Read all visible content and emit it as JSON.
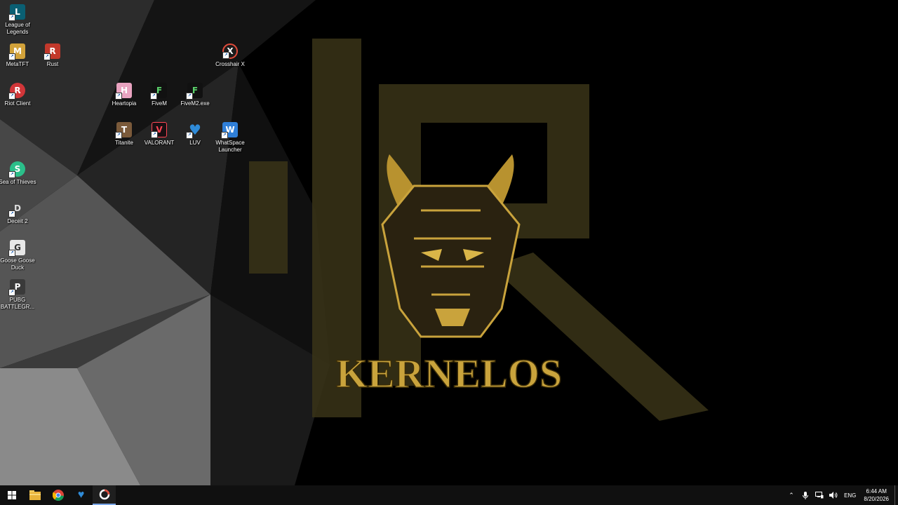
{
  "wallpaper": {
    "brand_text": "KERNELOS",
    "accent_color": "#c9a33c"
  },
  "desktop_icons": [
    {
      "label": "League of Legends",
      "icon": "league-of-legends-icon",
      "color": "#0a5f73",
      "glyph": "L"
    },
    {
      "label": "MetaTFT",
      "icon": "metatft-icon",
      "color": "#d2a23a",
      "glyph": "M"
    },
    {
      "label": "Rust",
      "icon": "rust-icon",
      "color": "#c2382b",
      "glyph": "R"
    },
    {
      "label": "Crosshair X",
      "icon": "crosshair-x-icon",
      "color": "#1b1b1b",
      "glyph": "X"
    },
    {
      "label": "Riot Client",
      "icon": "riot-client-icon",
      "color": "#d13639",
      "glyph": "R"
    },
    {
      "label": "Heartopia",
      "icon": "heartopia-icon",
      "color": "#e9a3c0",
      "glyph": "H"
    },
    {
      "label": "FiveM",
      "icon": "fivem-icon",
      "color": "#111111",
      "glyph": "F"
    },
    {
      "label": "FiveM2.exe",
      "icon": "fivem2-icon",
      "color": "#111111",
      "glyph": "F"
    },
    {
      "label": "Titanite",
      "icon": "titanite-icon",
      "color": "#7b5a3a",
      "glyph": "T"
    },
    {
      "label": "VALORANT",
      "icon": "valorant-icon",
      "color": "#1a0f12",
      "glyph": "V"
    },
    {
      "label": "LUV",
      "icon": "luv-icon",
      "color": "#2f8bd8",
      "glyph": "♥"
    },
    {
      "label": "WhatSpace Launcher",
      "icon": "whatspace-launcher-icon",
      "color": "#2f7fd8",
      "glyph": "W"
    },
    {
      "label": "Sea of Thieves",
      "icon": "sea-of-thieves-icon",
      "color": "#2bbf8a",
      "glyph": "S"
    },
    {
      "label": "Deceit 2",
      "icon": "deceit-2-icon",
      "color": "#8a8a8a",
      "glyph": "D"
    },
    {
      "label": "Goose Goose Duck",
      "icon": "goose-goose-duck-icon",
      "color": "#e7e7e7",
      "glyph": "G"
    },
    {
      "label": "PUBG BATTLEGR...",
      "icon": "pubg-icon",
      "color": "#3a3a3a",
      "glyph": "P"
    }
  ],
  "taskbar": {
    "apps": [
      {
        "icon": "windows-start-icon"
      },
      {
        "icon": "file-explorer-icon"
      },
      {
        "icon": "chrome-icon"
      },
      {
        "icon": "luv-taskbar-icon"
      },
      {
        "icon": "crosshair-x-taskbar-icon"
      }
    ],
    "tray": {
      "language": "ENG",
      "time": "6:44 AM",
      "date": "8/20/2026"
    }
  }
}
